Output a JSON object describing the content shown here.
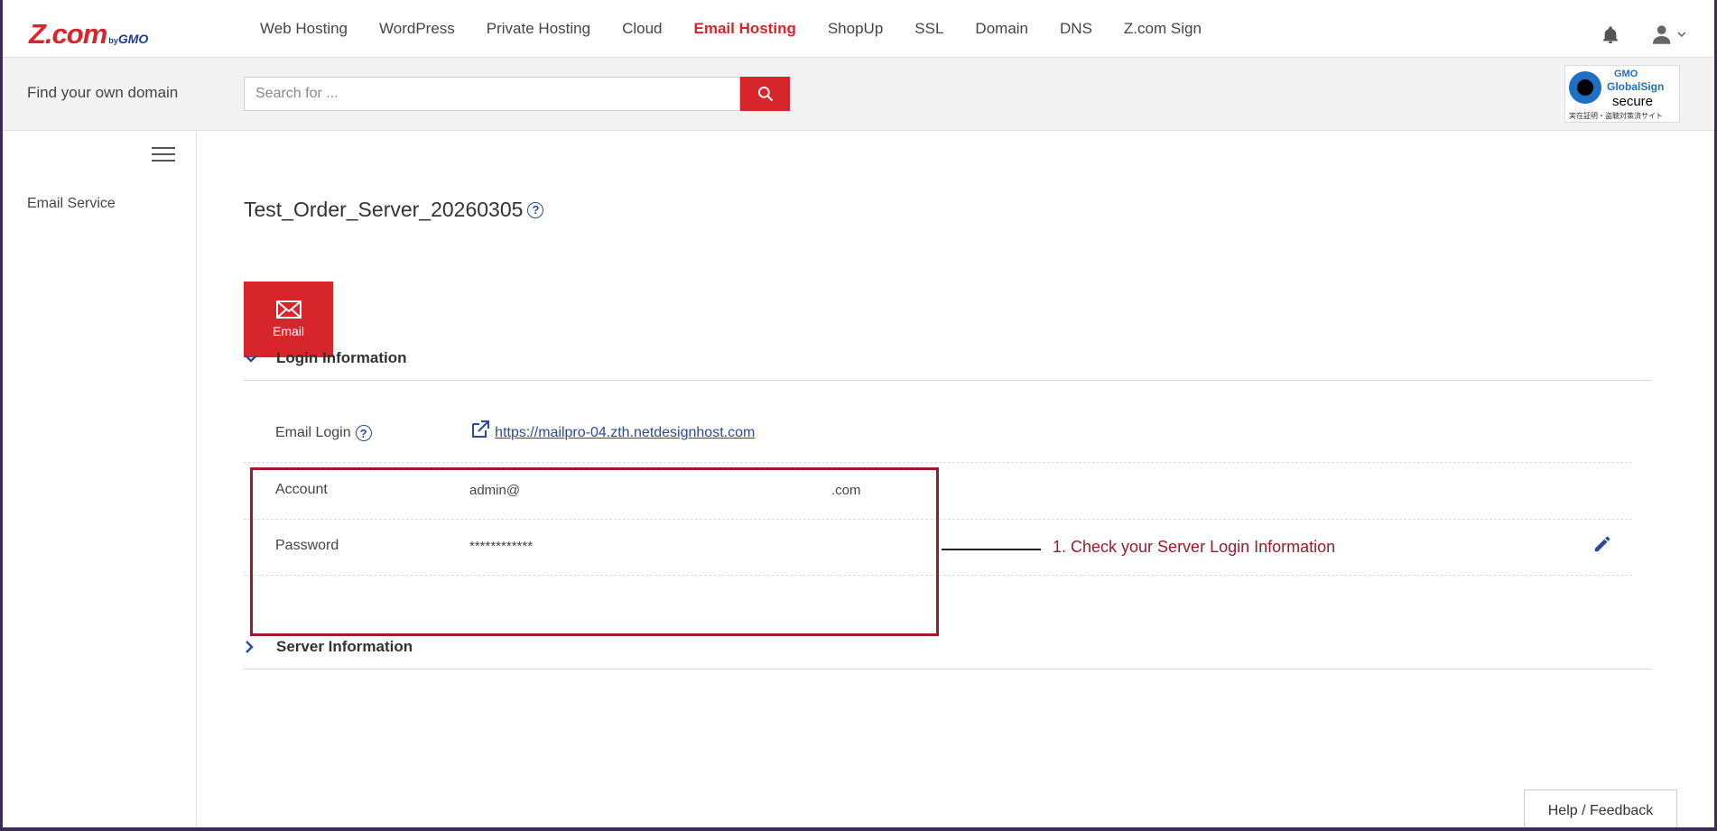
{
  "header": {
    "logo_text": "Z.com",
    "logo_by": "by",
    "logo_gmo": "GMO",
    "nav": [
      {
        "label": "Web Hosting",
        "active": false
      },
      {
        "label": "WordPress",
        "active": false
      },
      {
        "label": "Private Hosting",
        "active": false
      },
      {
        "label": "Cloud",
        "active": false
      },
      {
        "label": "Email Hosting",
        "active": true
      },
      {
        "label": "ShopUp",
        "active": false
      },
      {
        "label": "SSL",
        "active": false
      },
      {
        "label": "Domain",
        "active": false
      },
      {
        "label": "DNS",
        "active": false
      },
      {
        "label": "Z.com Sign",
        "active": false
      }
    ]
  },
  "searchbar": {
    "label": "Find your own domain",
    "placeholder": "Search for ...",
    "badge": {
      "gmo": "GMO",
      "globalsign": "GlobalSign",
      "secure": "secure",
      "jp": "実在証明・盗聴対策済サイト"
    }
  },
  "sidebar": {
    "items": [
      {
        "label": "Email Service"
      }
    ]
  },
  "main": {
    "title": "Test_Order_Server_20260305",
    "help_glyph": "?",
    "email_tile_label": "Email",
    "login_section": {
      "title": "Login Information",
      "rows": [
        {
          "label": "Email Login",
          "value": "https://mailpro-04.zth.netdesignhost.com"
        },
        {
          "label": "Account",
          "value_prefix": "admin@",
          "value_suffix": ".com"
        },
        {
          "label": "Password",
          "value": "************"
        }
      ]
    },
    "server_section": {
      "title": "Server Information"
    },
    "callout": "1. Check your Server Login Information",
    "help_feedback": "Help / Feedback"
  },
  "colors": {
    "brand_red": "#d6252b",
    "link_blue": "#2a4b9a",
    "highlight": "#9b1b27"
  }
}
